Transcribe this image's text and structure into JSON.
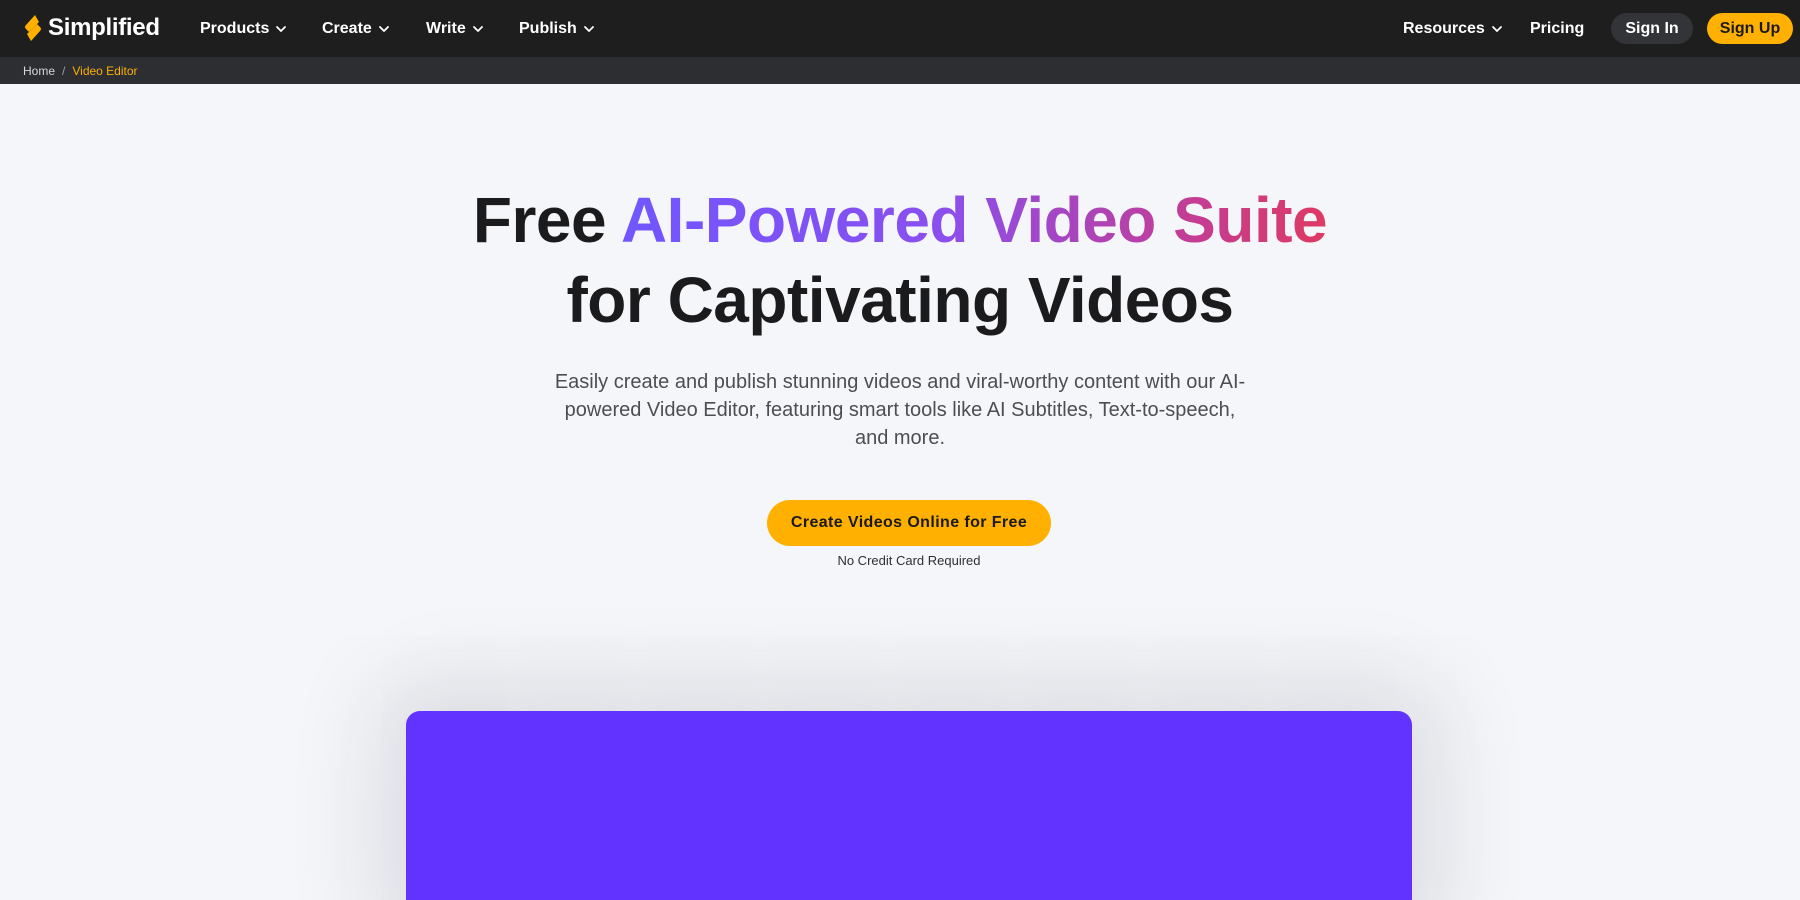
{
  "brand": {
    "name": "Simplified",
    "accent": "#ffb000",
    "video_card_color": "#6233ff"
  },
  "nav": {
    "left": [
      {
        "label": "Products",
        "chevron": "chevron-down-icon"
      },
      {
        "label": "Create",
        "chevron": "chevron-down-icon"
      },
      {
        "label": "Write",
        "chevron": "chevron-down-icon"
      },
      {
        "label": "Publish",
        "chevron": "chevron-down-icon"
      }
    ],
    "resources": {
      "label": "Resources",
      "chevron": "chevron-down-icon"
    },
    "pricing": "Pricing",
    "sign_in": "Sign In",
    "sign_up": "Sign Up"
  },
  "breadcrumb": {
    "home": "Home",
    "separator": "/",
    "current": "Video Editor"
  },
  "hero": {
    "title_plain_start": "Free ",
    "title_gradient": "AI-Powered Video Suite",
    "title_line2": "for Captivating Videos",
    "subtitle": "Easily create and publish stunning videos and viral-worthy content with our AI-powered Video Editor, featuring smart tools like AI Subtitles, Text-to-speech, and more.",
    "cta_label": "Create Videos Online for Free",
    "cta_note": "No Credit Card Required"
  }
}
